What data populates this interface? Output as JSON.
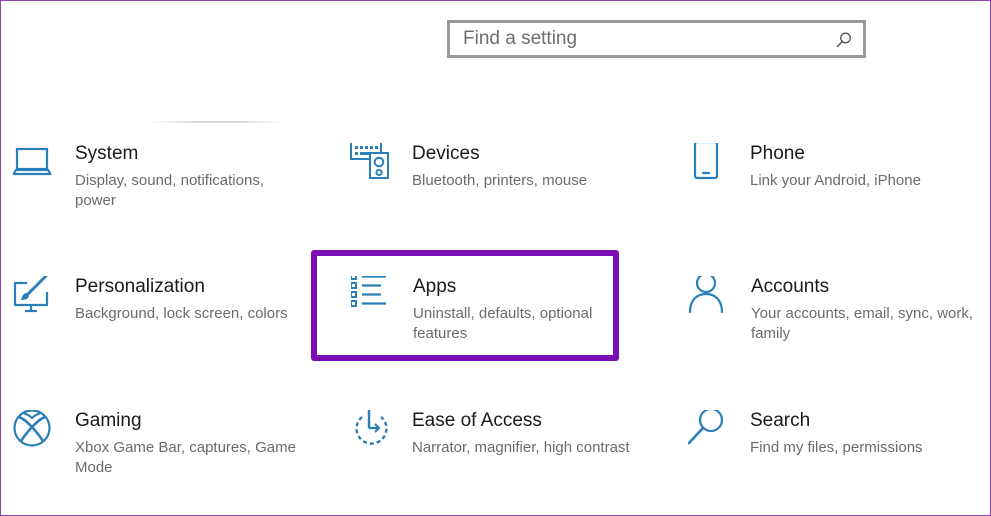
{
  "search": {
    "placeholder": "Find a setting"
  },
  "tiles": [
    {
      "title": "System",
      "desc": "Display, sound, notifications, power",
      "icon": "laptop-icon"
    },
    {
      "title": "Devices",
      "desc": "Bluetooth, printers, mouse",
      "icon": "keyboard-speaker-icon"
    },
    {
      "title": "Phone",
      "desc": "Link your Android, iPhone",
      "icon": "phone-icon"
    },
    {
      "title": "Personalization",
      "desc": "Background, lock screen, colors",
      "icon": "paintbrush-monitor-icon"
    },
    {
      "title": "Apps",
      "desc": "Uninstall, defaults, optional features",
      "icon": "apps-list-icon"
    },
    {
      "title": "Accounts",
      "desc": "Your accounts, email, sync, work, family",
      "icon": "person-icon"
    },
    {
      "title": "Gaming",
      "desc": "Xbox Game Bar, captures, Game Mode",
      "icon": "xbox-icon"
    },
    {
      "title": "Ease of Access",
      "desc": "Narrator, magnifier, high contrast",
      "icon": "ease-of-access-timer-icon"
    },
    {
      "title": "Search",
      "desc": "Find my files, permissions",
      "icon": "search-magnifier-icon"
    }
  ],
  "colors": {
    "icon_blue": "#2b7fb8",
    "highlight_purple": "#7a0fb5",
    "frame_purple": "#8e44ad"
  }
}
